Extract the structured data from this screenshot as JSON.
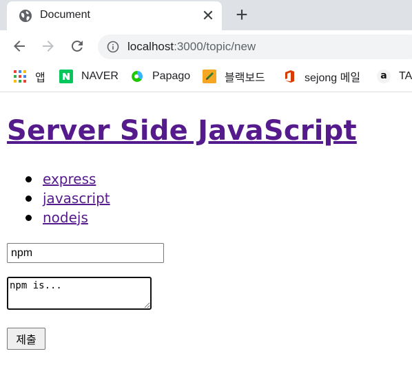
{
  "browser": {
    "tab": {
      "title": "Document"
    },
    "address": {
      "host": "localhost",
      "path": ":3000/topic/new"
    },
    "bookmarks": [
      {
        "label": "앱",
        "icon": "apps-grid-icon"
      },
      {
        "label": "NAVER",
        "icon": "naver-icon"
      },
      {
        "label": "Papago",
        "icon": "papago-icon"
      },
      {
        "label": "블랙보드",
        "icon": "blackboard-icon"
      },
      {
        "label": "sejong 메일",
        "icon": "office-icon"
      },
      {
        "label": "TA",
        "icon": "amazon-icon"
      }
    ]
  },
  "page": {
    "title": "Server Side JavaScript",
    "topics": [
      "express",
      "javascript",
      "nodejs"
    ],
    "form": {
      "title_value": "npm",
      "description_value": "npm is...",
      "submit_label": "제출"
    }
  }
}
